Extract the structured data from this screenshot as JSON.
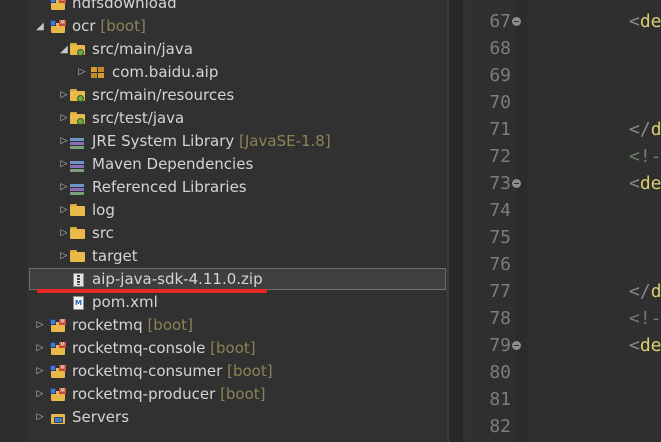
{
  "explorer": {
    "rows": [
      {
        "label": "hdfsdownload",
        "decoration": "",
        "icon": "project-icon"
      },
      {
        "label": "ocr",
        "decoration": "[boot]",
        "icon": "maven-project-icon",
        "expanded": true
      },
      {
        "label": "src/main/java",
        "decoration": "",
        "icon": "source-folder-icon",
        "expanded": true
      },
      {
        "label": "com.baidu.aip",
        "decoration": "",
        "icon": "package-icon"
      },
      {
        "label": "src/main/resources",
        "decoration": "",
        "icon": "source-folder-icon"
      },
      {
        "label": "src/test/java",
        "decoration": "",
        "icon": "source-folder-icon"
      },
      {
        "label": "JRE System Library",
        "decoration": "[JavaSE-1.8]",
        "icon": "library-icon"
      },
      {
        "label": "Maven Dependencies",
        "decoration": "",
        "icon": "library-icon"
      },
      {
        "label": "Referenced Libraries",
        "decoration": "",
        "icon": "library-icon"
      },
      {
        "label": "log",
        "decoration": "",
        "icon": "folder-icon"
      },
      {
        "label": "src",
        "decoration": "",
        "icon": "folder-icon"
      },
      {
        "label": "target",
        "decoration": "",
        "icon": "folder-icon"
      },
      {
        "label": "aip-java-sdk-4.11.0.zip",
        "decoration": "",
        "icon": "zip-file-icon",
        "selected": true
      },
      {
        "label": "pom.xml",
        "decoration": "",
        "icon": "xml-file-icon"
      },
      {
        "label": "rocketmq",
        "decoration": "[boot]",
        "icon": "maven-project-icon"
      },
      {
        "label": "rocketmq-console",
        "decoration": "[boot]",
        "icon": "maven-project-icon"
      },
      {
        "label": "rocketmq-consumer",
        "decoration": "[boot]",
        "icon": "maven-project-icon"
      },
      {
        "label": "rocketmq-producer",
        "decoration": "[boot]",
        "icon": "maven-project-icon"
      },
      {
        "label": "Servers",
        "decoration": "",
        "icon": "servers-folder-icon"
      }
    ],
    "annotation_color": "#e62a28"
  },
  "editor": {
    "lines": [
      {
        "num": "67",
        "fold": true,
        "code": [
          {
            "t": "<",
            "c": "punct"
          },
          {
            "t": "de",
            "c": "tag"
          }
        ]
      },
      {
        "num": "68",
        "fold": false,
        "code": []
      },
      {
        "num": "69",
        "fold": false,
        "code": []
      },
      {
        "num": "70",
        "fold": false,
        "code": []
      },
      {
        "num": "71",
        "fold": false,
        "code": [
          {
            "t": "</",
            "c": "punct"
          },
          {
            "t": "d",
            "c": "tag"
          }
        ]
      },
      {
        "num": "72",
        "fold": false,
        "code": [
          {
            "t": "<!-",
            "c": "comment"
          }
        ]
      },
      {
        "num": "73",
        "fold": true,
        "code": [
          {
            "t": "<",
            "c": "punct"
          },
          {
            "t": "de",
            "c": "tag"
          }
        ]
      },
      {
        "num": "74",
        "fold": false,
        "code": []
      },
      {
        "num": "75",
        "fold": false,
        "code": []
      },
      {
        "num": "76",
        "fold": false,
        "code": []
      },
      {
        "num": "77",
        "fold": false,
        "code": [
          {
            "t": "</",
            "c": "punct"
          },
          {
            "t": "d",
            "c": "tag"
          }
        ]
      },
      {
        "num": "78",
        "fold": false,
        "code": [
          {
            "t": "<!-",
            "c": "comment"
          }
        ]
      },
      {
        "num": "79",
        "fold": true,
        "code": [
          {
            "t": "<",
            "c": "punct"
          },
          {
            "t": "de",
            "c": "tag"
          }
        ]
      },
      {
        "num": "80",
        "fold": false,
        "code": []
      },
      {
        "num": "81",
        "fold": false,
        "code": []
      },
      {
        "num": "82",
        "fold": false,
        "code": []
      }
    ],
    "colors": {
      "tag": "#d9cf70",
      "punct": "#8a8a8a",
      "comment": "#6b7f6b",
      "line_number": "#7d7d7d"
    }
  }
}
